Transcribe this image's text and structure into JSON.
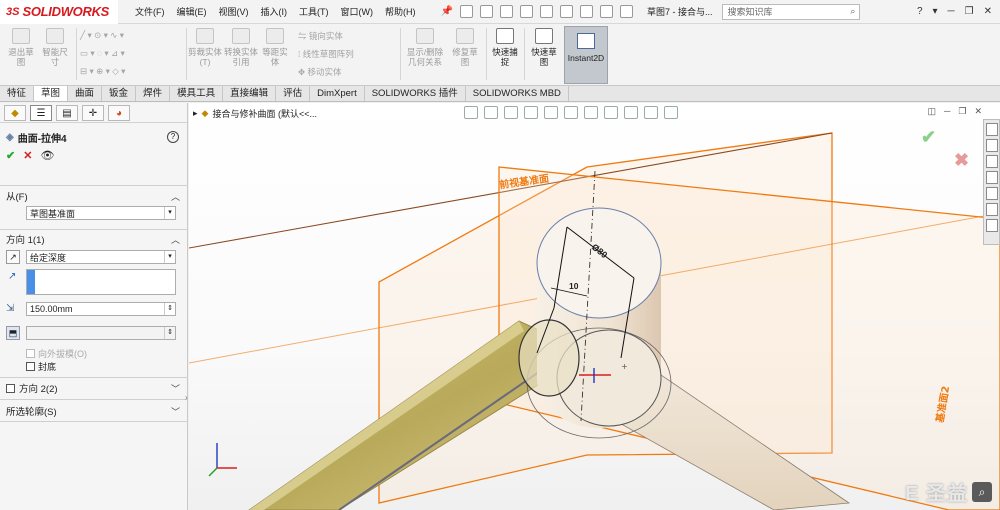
{
  "app": {
    "logo_ds": "3S",
    "logo_name": "SOLIDWORKS"
  },
  "menu": [
    "文件(F)",
    "编辑(E)",
    "视图(V)",
    "插入(I)",
    "工具(T)",
    "窗口(W)",
    "帮助(H)"
  ],
  "document_title": "草图7 - 接合与...",
  "search": {
    "placeholder": "搜索知识库"
  },
  "ribbon": {
    "exit_sketch": "退出草图",
    "smart_dimension": "智能尺寸",
    "trim": "剪裁实体(T)",
    "convert": "转换实体引用",
    "offset": "等距实体",
    "mirror": "镜向实体",
    "linear_pattern": "线性草图阵列",
    "move": "移动实体",
    "relations": "显示/删除几何关系",
    "repair": "修复草图",
    "quick_snap": "快速捕捉",
    "rapid_sketch": "快速草图",
    "instant2d": "Instant2D"
  },
  "tabs": [
    "特征",
    "草图",
    "曲面",
    "钣金",
    "焊件",
    "模具工具",
    "直接编辑",
    "评估",
    "DimXpert",
    "SOLIDWORKS 插件",
    "SOLIDWORKS MBD"
  ],
  "active_tab": "草图",
  "feature_tree_label": "接合与修补曲面 (默认<<...",
  "property_manager": {
    "title": "曲面-拉伸4",
    "from_label": "从(F)",
    "from_value": "草图基准面",
    "dir1_label": "方向 1(1)",
    "dir1_type": "给定深度",
    "depth_value": "150.00mm",
    "draft_label": "向外拔模(O)",
    "cap_label": "封底",
    "dir2_label": "方向 2(2)",
    "contours_label": "所选轮廓(S)"
  },
  "viewport": {
    "front_plane_label": "前视基准面",
    "plane2_label": "基准面2",
    "dim_diameter": "Ø80",
    "dim_ten": "10"
  },
  "watermark": {
    "text": "E 圣益"
  },
  "colors": {
    "logo_red": "#d8191f",
    "plane_orange": "#f07a10",
    "plane_dark_line": "#8a4a22",
    "cylinder_fill": "#ede3d2",
    "bar_fill": "#c4b56a"
  }
}
